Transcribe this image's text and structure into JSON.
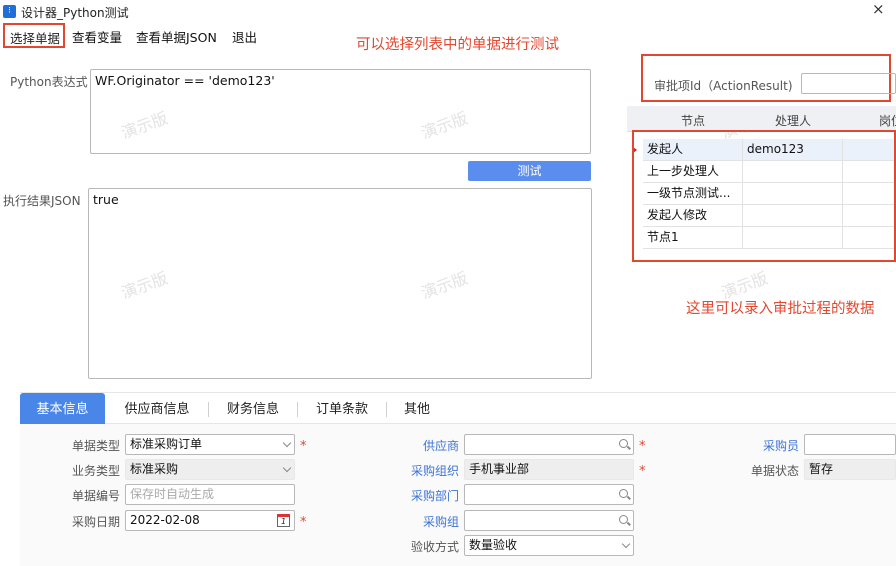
{
  "window": {
    "title": "设计器_Python测试",
    "close_glyph": "×"
  },
  "menu": {
    "select_doc": "选择单据",
    "view_vars": "查看变量",
    "view_json": "查看单据JSON",
    "exit": "退出"
  },
  "notes": {
    "select_hint": "可以选择列表中的单据进行测试",
    "grid_hint": "这里可以录入审批过程的数据"
  },
  "python": {
    "label": "Python表达式",
    "expression": "WF.Originator == 'demo123'"
  },
  "test_button": "测试",
  "result": {
    "label": "执行结果JSON",
    "value": "true"
  },
  "approval": {
    "label": "审批项Id（ActionResult)",
    "value": ""
  },
  "grid": {
    "columns": [
      "节点",
      "处理人",
      "岗位"
    ],
    "rows": [
      [
        "发起人",
        "demo123",
        ""
      ],
      [
        "上一步处理人",
        "",
        ""
      ],
      [
        "一级节点测试...",
        "",
        ""
      ],
      [
        "发起人修改",
        "",
        ""
      ],
      [
        "节点1",
        "",
        ""
      ]
    ]
  },
  "tabs": [
    "基本信息",
    "供应商信息",
    "财务信息",
    "订单条款",
    "其他"
  ],
  "form": {
    "doc_type": {
      "label": "单据类型",
      "value": "标准采购订单"
    },
    "biz_type": {
      "label": "业务类型",
      "value": "标准采购"
    },
    "doc_no": {
      "label": "单据编号",
      "placeholder": "保存时自动生成"
    },
    "purchase_date": {
      "label": "采购日期",
      "value": "2022-02-08",
      "calendar_day": "1"
    },
    "supplier": {
      "label": "供应商",
      "value": ""
    },
    "purchase_org": {
      "label": "采购组织",
      "value": "手机事业部"
    },
    "purchase_dept": {
      "label": "采购部门",
      "value": ""
    },
    "purchase_group": {
      "label": "采购组",
      "value": ""
    },
    "acceptance": {
      "label": "验收方式",
      "value": "数量验收"
    },
    "buyer": {
      "label": "采购员",
      "value": ""
    },
    "doc_status": {
      "label": "单据状态",
      "value": "暂存"
    },
    "required_mark": "*"
  },
  "watermark": "演示版",
  "colors": {
    "accent": "#4a86e8",
    "button": "#5b8def",
    "annotation": "#e2472f"
  }
}
